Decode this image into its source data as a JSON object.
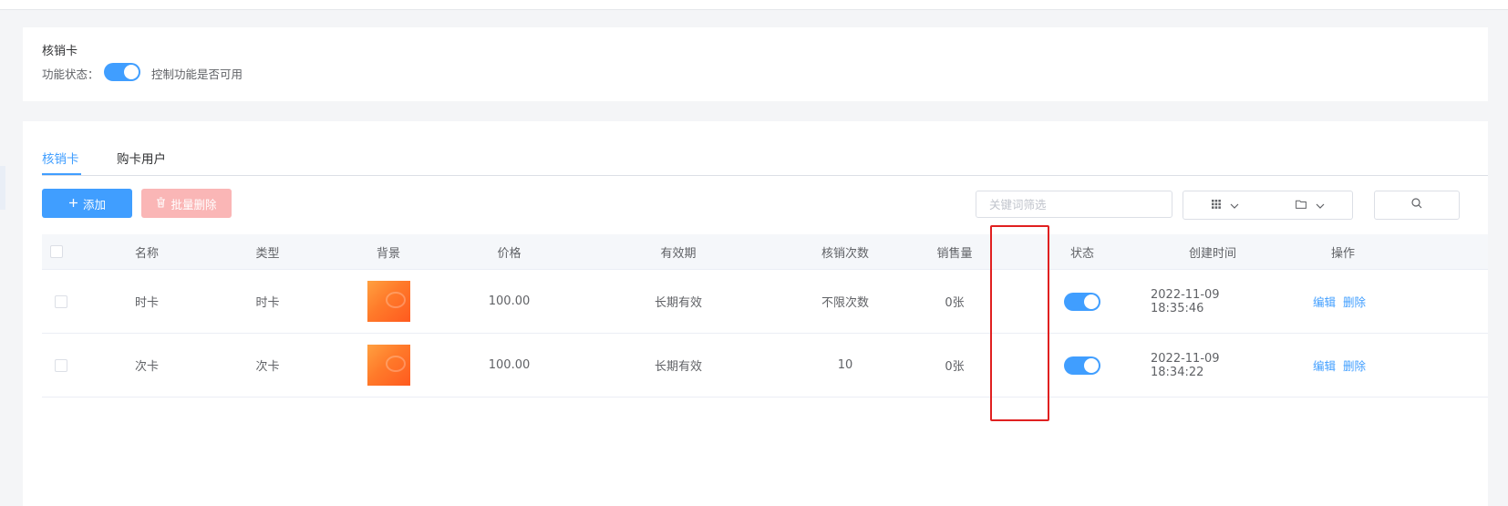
{
  "module": {
    "title": "核销卡",
    "status_label": "功能状态：",
    "status_on": true,
    "status_desc": "控制功能是否可用"
  },
  "tabs": [
    {
      "label": "核销卡",
      "active": true
    },
    {
      "label": "购卡用户",
      "active": false
    }
  ],
  "toolbar": {
    "add_label": "添加",
    "batch_delete_label": "批量删除",
    "search_placeholder": "关键词筛选"
  },
  "table": {
    "columns": [
      "名称",
      "类型",
      "背景",
      "价格",
      "有效期",
      "核销次数",
      "销售量",
      "状态",
      "创建时间",
      "操作"
    ],
    "rows": [
      {
        "name": "时卡",
        "type": "时卡",
        "price": "100.00",
        "validity": "长期有效",
        "uses": "不限次数",
        "sales": "0张",
        "enabled": true,
        "created": "2022-11-09 18:35:46",
        "edit": "编辑",
        "delete": "删除"
      },
      {
        "name": "次卡",
        "type": "次卡",
        "price": "100.00",
        "validity": "长期有效",
        "uses": "10",
        "sales": "0张",
        "enabled": true,
        "created": "2022-11-09 18:34:22",
        "edit": "编辑",
        "delete": "删除"
      }
    ]
  },
  "icons": {
    "add": "plus-icon",
    "batch_delete": "trash-icon",
    "grid": "grid-icon",
    "folder": "folder-icon",
    "search": "search-icon",
    "dropdown": "chevron-down-icon"
  },
  "colors": {
    "primary": "#409eff",
    "danger_light": "#fab6b6",
    "highlight": "#e02020"
  }
}
